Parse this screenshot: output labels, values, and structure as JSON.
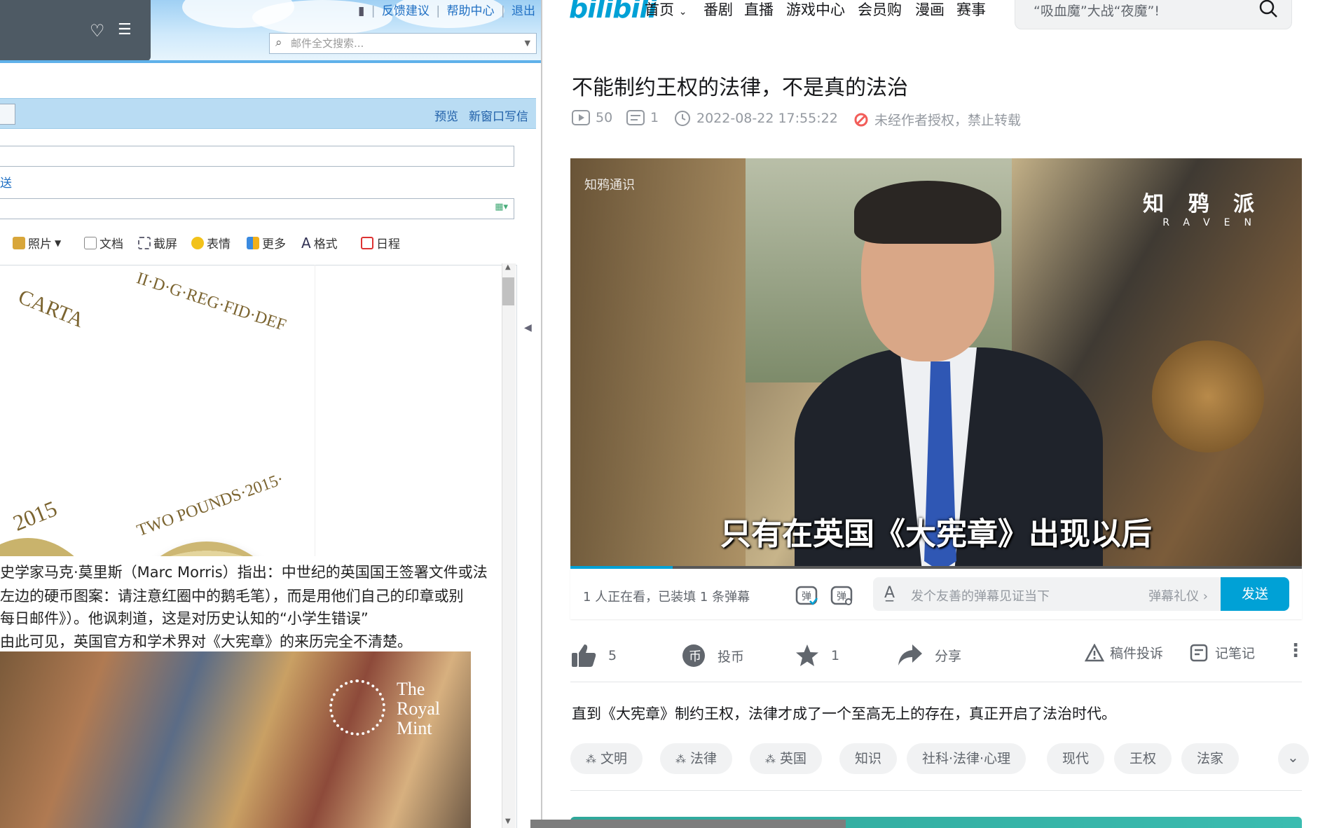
{
  "left_pane": {
    "top_links": {
      "feedback": "反馈建议",
      "help": "帮助中心",
      "logout": "退出"
    },
    "search": {
      "placeholder": "邮件全文搜索..."
    },
    "tab_bar": {
      "preview": "预览",
      "new_window": "新窗口写信"
    },
    "partial_label": "送",
    "toolbar": {
      "photo": "照片",
      "document": "文档",
      "screenshot": "截屏",
      "emoji": "表情",
      "more": "更多",
      "format": "格式",
      "calendar": "日程"
    },
    "coin_text": {
      "left_top": "CARTA",
      "left_year": "2015",
      "right_top": "II·D·G·REG·FID·DEF",
      "right_bottom": "TWO POUNDS·2015·"
    },
    "body_lines": [
      "史学家马克·莫里斯（Marc Morris）指出：中世纪的英国国王签署文件或法",
      "左边的硬币图案：请注意红圈中的鹅毛笔），而是用他们自己的印章或别",
      "每日邮件》）。他讽刺道，这是对历史认知的“小学生错误”",
      "由此可见，英国官方和学术界对《大宪章》的来历完全不清楚。"
    ],
    "painting_watermark": [
      "The",
      "Royal",
      "Mint"
    ]
  },
  "right_pane": {
    "logo": "bilibili",
    "nav": [
      "首页",
      "番剧",
      "直播",
      "游戏中心",
      "会员购",
      "漫画",
      "赛事"
    ],
    "search_placeholder": "“吸血魔”大战“夜魔”!",
    "video_title": "不能制约王权的法律，不是真的法治",
    "meta": {
      "plays": "50",
      "danmaku": "1",
      "datetime": "2022-08-22 17:55:22",
      "copyright": "未经作者授权，禁止转载"
    },
    "player": {
      "watermark_left": "知鸦通识",
      "watermark_right": "知 鸦 派",
      "watermark_right_sub": "RAVEN",
      "subtitle": "只有在英国《大宪章》出现以后",
      "progress": 0.14
    },
    "danmaku_bar": {
      "viewers": "1 人正在看，已装填 1 条弹幕",
      "input_placeholder": "发个友善的弹幕见证当下",
      "etiquette": "弹幕礼仪",
      "send": "发送"
    },
    "actions": {
      "like_count": "5",
      "coin": "投币",
      "favorite_count": "1",
      "share": "分享",
      "report": "稿件投诉",
      "notes": "记笔记"
    },
    "description": "直到《大宪章》制约王权，法律才成了一个至高无上的存在，真正开启了法治时代。",
    "tags": [
      "文明",
      "法律",
      "英国",
      "知识",
      "社科·法律·心理",
      "现代",
      "王权",
      "法家"
    ]
  },
  "colors": {
    "bilibili_blue": "#00a1d6",
    "mail_blue": "#1f6fc3"
  }
}
